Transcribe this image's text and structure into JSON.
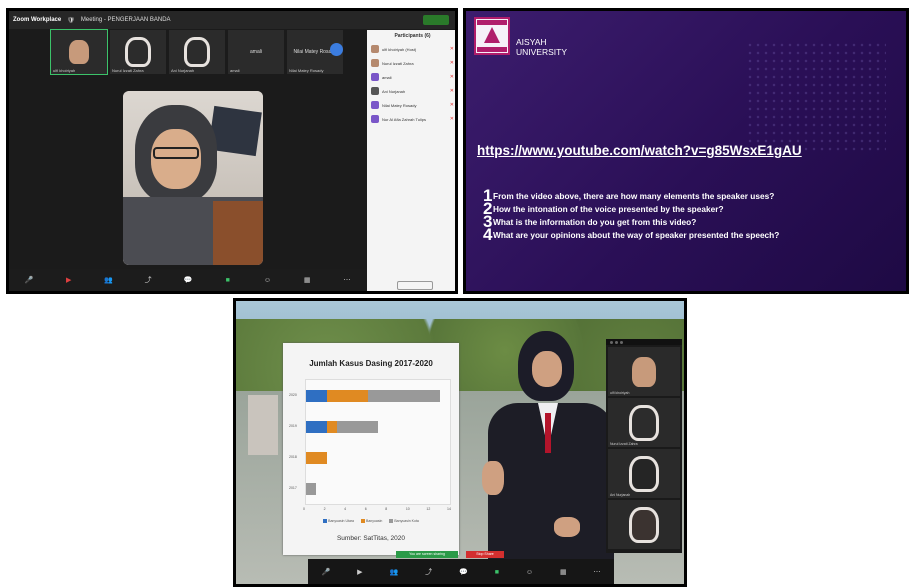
{
  "meeting": {
    "app_name": "Zoom Workplace",
    "title": "Meeting - PENGERJAAN BANDA",
    "participants_header": "Participants (6)",
    "gallery_names": [
      "ulfi khoiriyah",
      "Nurul Izzati Zahra",
      "Ani Nurjanah",
      "amali",
      "Nilai Matey Rosady"
    ],
    "gallery_tile_texts": [
      "",
      "",
      "",
      "amali",
      "Nilai Matey Rosady"
    ],
    "participants": [
      {
        "name": "ulfi khoiriyah (Host)",
        "avatar": "photo"
      },
      {
        "name": "Nurul Izzati Zahra",
        "avatar": "photo"
      },
      {
        "name": "amali",
        "avatar": "initial"
      },
      {
        "name": "Ani Nurjanah",
        "avatar": "photo"
      },
      {
        "name": "Nilai Matey Rosady",
        "avatar": "initial"
      },
      {
        "name": "Nur Al Afia Zahrah Tulips",
        "avatar": "initial"
      }
    ],
    "toolbar_icons": [
      "mic-icon",
      "video-icon",
      "participants-icon",
      "share-icon",
      "chat-icon",
      "record-icon",
      "reactions-icon",
      "apps-icon",
      "more-icon",
      "leave-icon"
    ]
  },
  "slide": {
    "university": [
      "AISYAH",
      "UNIVERSITY"
    ],
    "video_link": "https://www.youtube.com/watch?v=g85WsxE1gAU",
    "questions": [
      {
        "num": "1",
        "text": "From the video above, there are how many elements the speaker uses?"
      },
      {
        "num": "2",
        "text": "How the intonation of the voice presented by the speaker?"
      },
      {
        "num": "3",
        "text": "What is the information do you get from this video?"
      },
      {
        "num": "4",
        "text": "What are your opinions about the way of speaker presented the speech?"
      }
    ]
  },
  "presentation": {
    "chart_data": {
      "type": "bar",
      "orientation": "horizontal",
      "stacked": true,
      "title": "Jumlah Kasus Dasing 2017-2020",
      "categories": [
        "2020",
        "2019",
        "2018",
        "2017"
      ],
      "series": [
        {
          "name": "Banyuasin Utara",
          "color": "#2f6fc2",
          "values": [
            2,
            2,
            0,
            0
          ]
        },
        {
          "name": "Banyuasin",
          "color": "#e08a22",
          "values": [
            4,
            1,
            2,
            0
          ]
        },
        {
          "name": "Banyuasin Kota",
          "color": "#999999",
          "values": [
            7,
            4,
            0,
            1
          ]
        }
      ],
      "xlim": [
        0,
        14
      ],
      "xticks": [
        "0",
        "2",
        "4",
        "6",
        "8",
        "10",
        "12",
        "14"
      ],
      "source": "Sumber: SatTitas, 2020"
    },
    "gallery_names": [
      "ulfi khoiriyah",
      "Nurul Izzati Zahra",
      "Ani Nurjanah",
      ""
    ],
    "share_label": "You are screen sharing",
    "stop_label": "Stop Share",
    "toolbar_icons": [
      "mic-icon",
      "video-icon",
      "participants-icon",
      "share-icon",
      "chat-icon",
      "record-icon",
      "reactions-icon",
      "apps-icon",
      "more-icon"
    ]
  }
}
